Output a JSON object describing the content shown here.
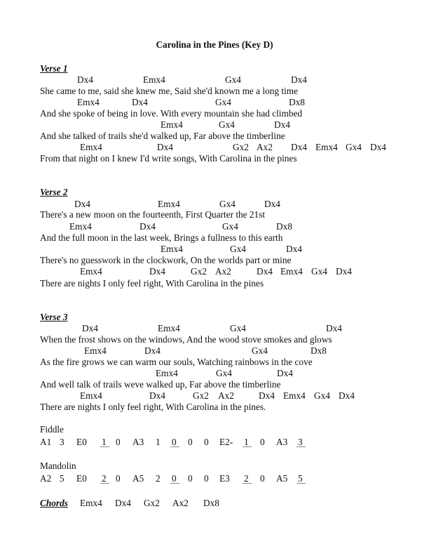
{
  "title": "Carolina in the Pines (Key D)",
  "verses": [
    {
      "heading": "Verse 1",
      "lines": [
        {
          "chords": [
            "Dx4",
            "Emx4",
            "Gx4",
            "Dx4"
          ],
          "lyric": "She came to me, said she knew me, Said she'd known me a long time"
        },
        {
          "chords": [
            "Emx4",
            "Dx4",
            "Gx4",
            "Dx8"
          ],
          "lyric": "And she spoke of being in love. With every mountain she had climbed"
        },
        {
          "chords": [
            "Emx4",
            "Gx4",
            "Dx4"
          ],
          "lyric": "And she talked of trails she'd walked up, Far above the timberline"
        },
        {
          "chords": [
            "Emx4",
            "Dx4",
            "Gx2",
            "Ax2",
            "Dx4",
            "Emx4",
            "Gx4",
            "Dx4"
          ],
          "lyric": "From that night on I knew I'd write songs, With Carolina in the pines"
        }
      ]
    },
    {
      "heading": "Verse 2",
      "lines": [
        {
          "chords": [
            "Dx4",
            "Emx4",
            "Gx4",
            "Dx4"
          ],
          "lyric": "There's a new moon on the fourteenth, First Quarter the 21st"
        },
        {
          "chords": [
            "Emx4",
            "Dx4",
            "Gx4",
            "Dx8"
          ],
          "lyric": "And the full moon in the last week, Brings a fullness to this earth"
        },
        {
          "chords": [
            "Emx4",
            "Gx4",
            "Dx4"
          ],
          "lyric": "There's no guesswork in the clockwork, On the worlds part or mine"
        },
        {
          "chords": [
            "Emx4",
            "Dx4",
            "Gx2",
            "Ax2",
            "Dx4",
            "Emx4",
            "Gx4",
            "Dx4"
          ],
          "lyric": "There are nights I only feel right, With Carolina in the pines"
        }
      ]
    },
    {
      "heading": "Verse 3",
      "lines": [
        {
          "chords": [
            "Dx4",
            "Emx4",
            "Gx4",
            "Dx4"
          ],
          "lyric": "When the frost shows on the windows, And the wood stove smokes and glows"
        },
        {
          "chords": [
            "Emx4",
            "Dx4",
            "Gx4",
            "Dx8"
          ],
          "lyric": "As the fire grows we can warm our souls, Watching rainbows in the cove"
        },
        {
          "chords": [
            "Emx4",
            "Gx4",
            "Dx4"
          ],
          "lyric": "And well talk of trails weve walked up, Far above the timberline"
        },
        {
          "chords": [
            "Emx4",
            "Dx4",
            "Gx2",
            "Ax2",
            "Dx4",
            "Emx4",
            "Gx4",
            "Dx4"
          ],
          "lyric": "There are nights I only feel right, With Carolina in the pines."
        }
      ]
    }
  ],
  "fiddle": {
    "label": "Fiddle",
    "notes": [
      {
        "t": "A1",
        "u": false
      },
      {
        "t": "3",
        "u": false
      },
      {
        "t": "E0",
        "u": false
      },
      {
        "t": "1",
        "u": true
      },
      {
        "t": "0",
        "u": false
      },
      {
        "t": "A3",
        "u": false
      },
      {
        "t": "1",
        "u": false
      },
      {
        "t": "0",
        "u": true
      },
      {
        "t": "0",
        "u": false
      },
      {
        "t": "0",
        "u": false
      },
      {
        "t": "E2-",
        "u": false
      },
      {
        "t": "1",
        "u": true
      },
      {
        "t": "0",
        "u": false
      },
      {
        "t": "A3",
        "u": false
      },
      {
        "t": "3",
        "u": true
      }
    ]
  },
  "mandolin": {
    "label": "Mandolin",
    "notes": [
      {
        "t": "A2",
        "u": false
      },
      {
        "t": "5",
        "u": false
      },
      {
        "t": "E0",
        "u": false
      },
      {
        "t": "2",
        "u": true
      },
      {
        "t": "0",
        "u": false
      },
      {
        "t": "A5",
        "u": false
      },
      {
        "t": "2",
        "u": false
      },
      {
        "t": "0",
        "u": true
      },
      {
        "t": "0",
        "u": false
      },
      {
        "t": "0",
        "u": false
      },
      {
        "t": "E3",
        "u": false
      },
      {
        "t": "2",
        "u": true
      },
      {
        "t": "0",
        "u": false
      },
      {
        "t": "A5",
        "u": false
      },
      {
        "t": "5",
        "u": true
      }
    ]
  },
  "chords_summary": {
    "label": "Chords",
    "items": [
      "Emx4",
      "Dx4",
      "Gx2",
      "Ax2",
      "Dx8"
    ]
  }
}
